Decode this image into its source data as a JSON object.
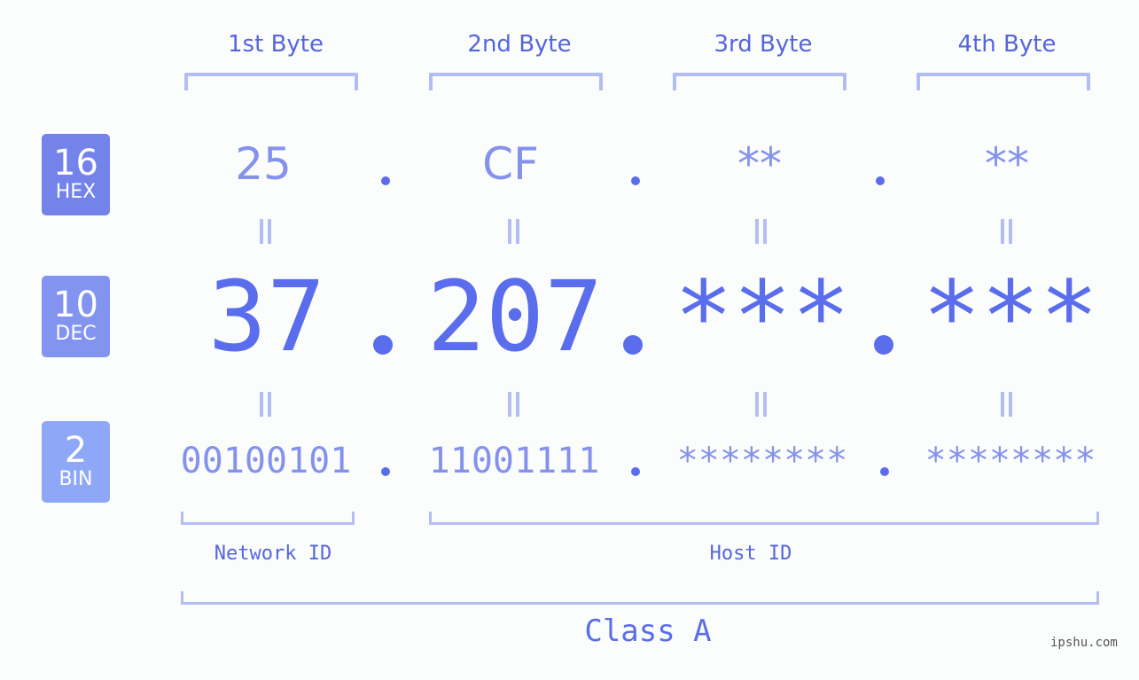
{
  "headers": [
    "1st Byte",
    "2nd Byte",
    "3rd Byte",
    "4th Byte"
  ],
  "bases": {
    "hex": {
      "number": "16",
      "label": "HEX"
    },
    "dec": {
      "number": "10",
      "label": "DEC"
    },
    "bin": {
      "number": "2",
      "label": "BIN"
    }
  },
  "hex": [
    "25",
    "CF",
    "**",
    "**"
  ],
  "dec": [
    "37",
    "207",
    "***",
    "***"
  ],
  "bin": [
    "00100101",
    "11001111",
    "********",
    "********"
  ],
  "separator": ".",
  "sections": {
    "network": "Network ID",
    "host": "Host ID",
    "class": "Class A"
  },
  "watermark": "ipshu.com",
  "colors": {
    "accent": "#5a6ded",
    "light_accent": "#8492ee",
    "bracket": "#b3bdf5",
    "badge_hex": "#7383ea",
    "badge_dec": "#8394f0",
    "badge_bin": "#8ea8f7"
  }
}
